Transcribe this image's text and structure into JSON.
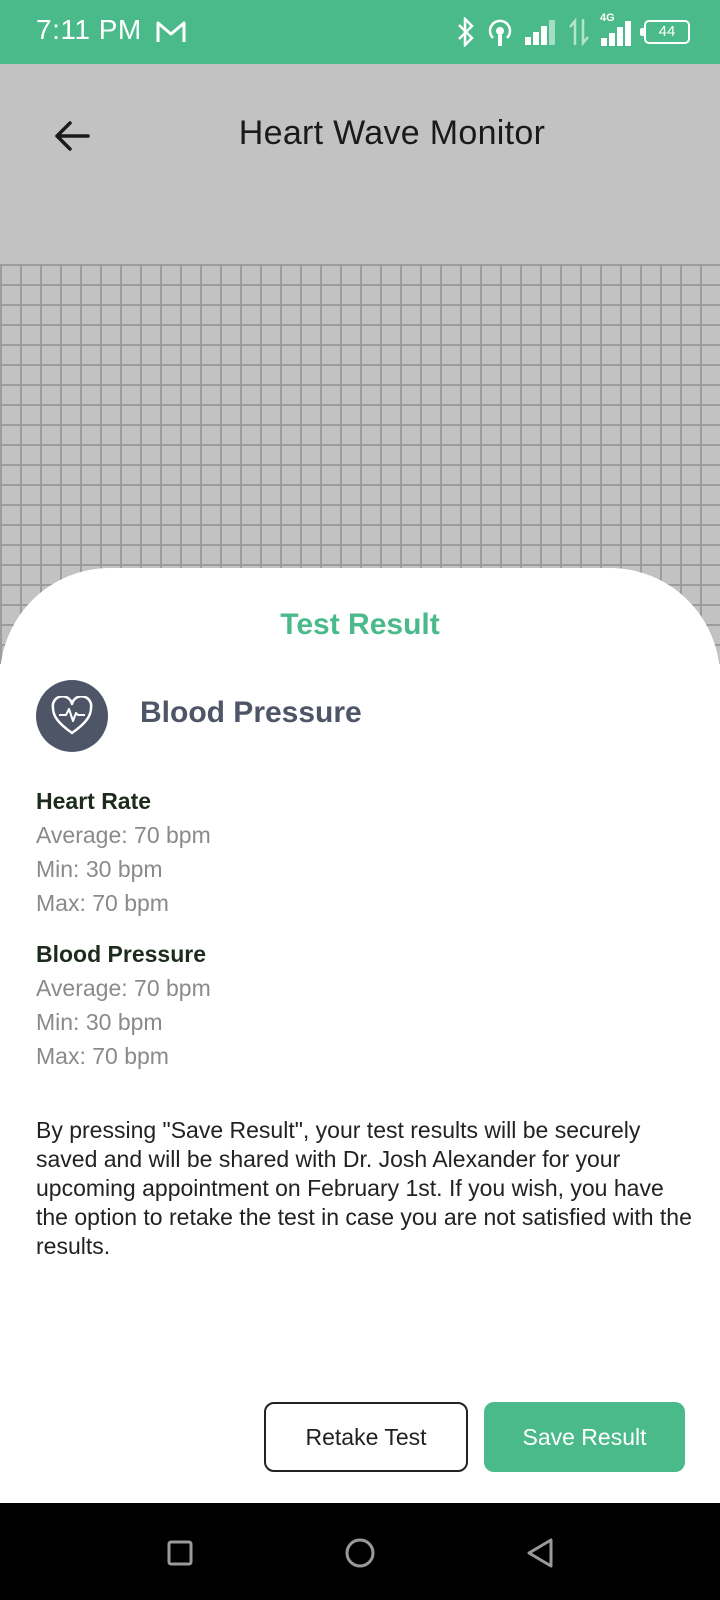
{
  "status": {
    "time": "7:11 PM",
    "battery": "44",
    "network": "4G"
  },
  "header": {
    "title": "Heart Wave Monitor"
  },
  "sheet": {
    "title": "Test Result",
    "test_name": "Blood Pressure",
    "sections": [
      {
        "heading": "Heart Rate",
        "average": "Average: 70 bpm",
        "min": "Min: 30 bpm",
        "max": "Max: 70 bpm"
      },
      {
        "heading": "Blood Pressure",
        "average": "Average: 70 bpm",
        "min": "Min: 30 bpm",
        "max": "Max: 70 bpm"
      }
    ],
    "note": "By pressing \"Save Result\", your test results will be securely saved and will be shared with Dr. Josh Alexander for your upcoming appointment on February 1st. If you wish, you have the option to retake the test in case you are not satisfied with the results.",
    "retake_label": "Retake Test",
    "save_label": "Save Result"
  },
  "colors": {
    "accent": "#4aba8a",
    "header_bg": "#c2c2c2",
    "icon_bg": "#4d5566"
  },
  "icons": {
    "back": "arrow-left-icon",
    "test": "heart-pulse-icon",
    "nav": [
      "square-icon",
      "circle-icon",
      "triangle-back-icon"
    ]
  }
}
